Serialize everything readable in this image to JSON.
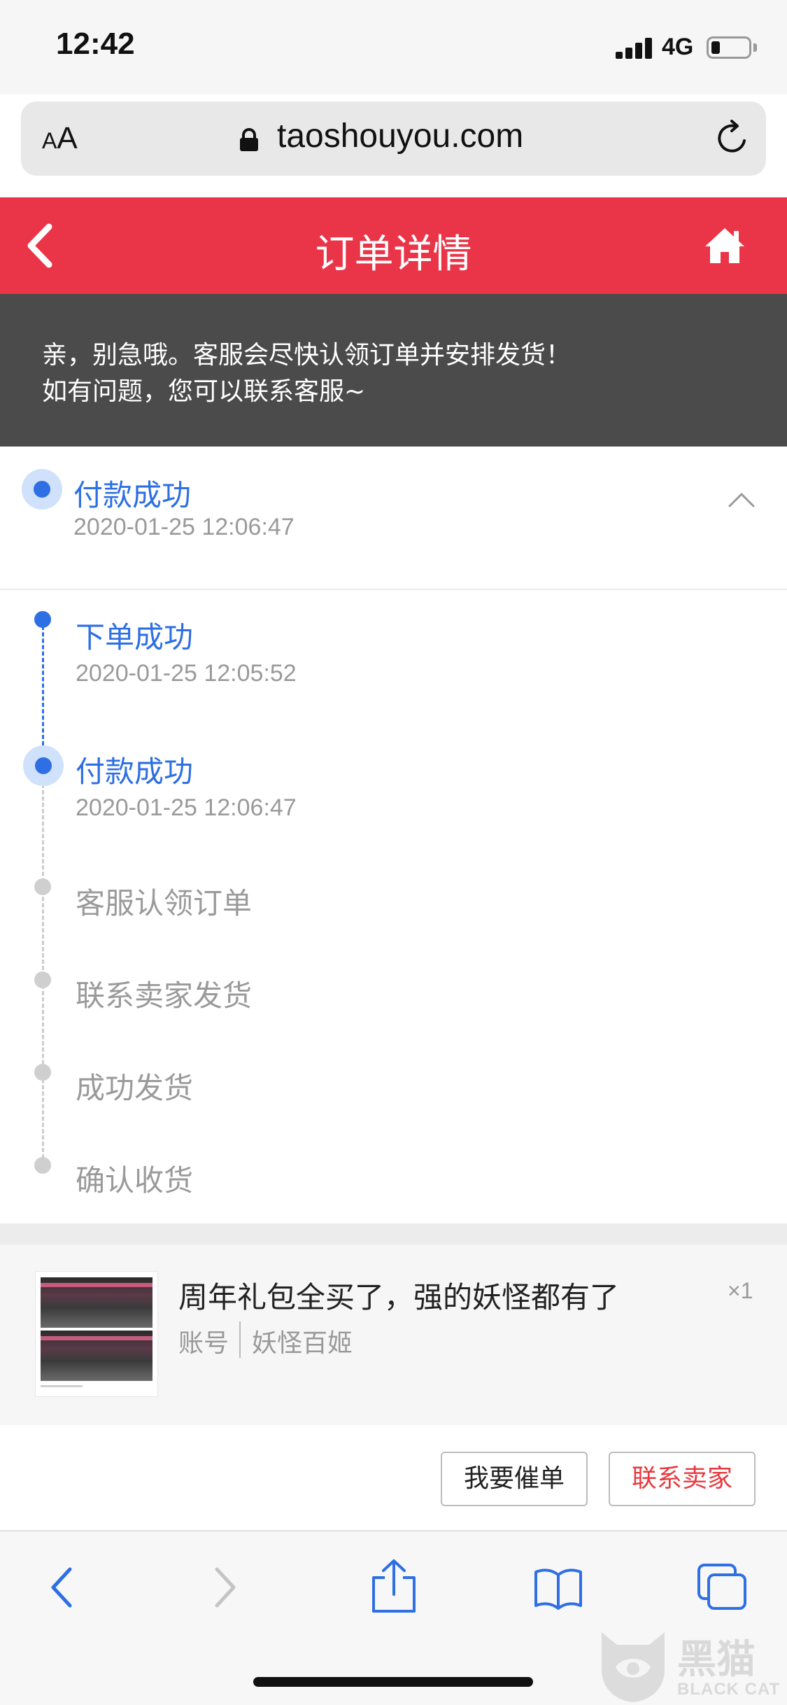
{
  "status_bar": {
    "time": "12:42",
    "network": "4G"
  },
  "browser": {
    "text_size_label_small": "A",
    "text_size_label_large": "A",
    "url": "taoshouyou.com"
  },
  "header": {
    "title": "订单详情"
  },
  "notice": {
    "line1": "亲，别急哦。客服会尽快认领订单并安排发货！",
    "line2": "如有问题，您可以联系客服~"
  },
  "current_status": {
    "label": "付款成功",
    "time": "2020-01-25 12:06:47"
  },
  "timeline": [
    {
      "label": "下单成功",
      "time": "2020-01-25 12:05:52",
      "state": "done"
    },
    {
      "label": "付款成功",
      "time": "2020-01-25 12:06:47",
      "state": "current"
    },
    {
      "label": "客服认领订单",
      "state": "pending"
    },
    {
      "label": "联系卖家发货",
      "state": "pending"
    },
    {
      "label": "成功发货",
      "state": "pending"
    },
    {
      "label": "确认收货",
      "state": "pending"
    }
  ],
  "product": {
    "title": "周年礼包全买了，强的妖怪都有了",
    "quantity": "×1",
    "type": "账号",
    "game": "妖怪百姬"
  },
  "actions": {
    "urge_label": "我要催单",
    "contact_seller_label": "联系卖家"
  },
  "watermark": {
    "text": "黑猫",
    "sub": "BLACK CAT"
  },
  "colors": {
    "brand_red": "#ea3549",
    "accent_blue": "#2e6fe3",
    "notice_bg": "#4b4b4b"
  }
}
